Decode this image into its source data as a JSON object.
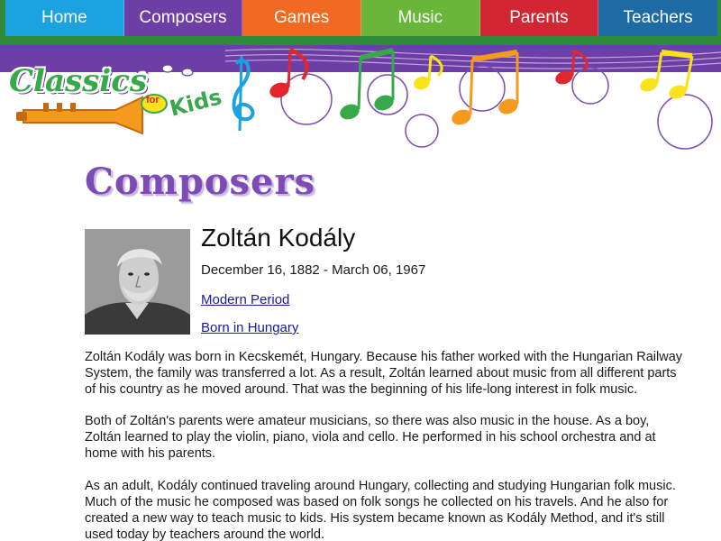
{
  "nav": {
    "items": [
      {
        "label": "Home",
        "color": "#1aa3e0"
      },
      {
        "label": "Composers",
        "color": "#6d3fa6"
      },
      {
        "label": "Games",
        "color": "#f26a22"
      },
      {
        "label": "Music",
        "color": "#6ab63a"
      },
      {
        "label": "Parents",
        "color": "#d32633"
      },
      {
        "label": "Teachers",
        "color": "#1d6aa5"
      }
    ]
  },
  "brand": {
    "logo_text": "Classics",
    "logo_for": "for",
    "logo_kids": "Kids"
  },
  "page": {
    "heading": "Composers"
  },
  "composer": {
    "name": "Zoltán Kodály",
    "dates": "December 16, 1882 - March 06, 1967",
    "period_link": "Modern Period",
    "born_link": "Born in Hungary",
    "paragraphs": [
      "Zoltán Kodály was born in Kecskemét, Hungary. Because his father worked with the Hungarian Railway System, the family was transferred a lot. As a result, Zoltán learned about music from all different parts of his country as he moved around. That was the beginning of his life-long interest in folk music.",
      "Both of Zoltán's parents were amateur musicians, so there was also music in the house. As a boy, Zoltán learned to play the violin, piano, viola and cello. He performed in his school orchestra and at home with his parents.",
      "As an adult, Kodály continued traveling around Hungary, collecting and studying Hungarian folk music. Much of the music he composed was based on folk songs he collected on his travels. And he also for created a new way to teach music to kids. His system became known as Kodály Method, and it's still used today by teachers around the world."
    ]
  }
}
